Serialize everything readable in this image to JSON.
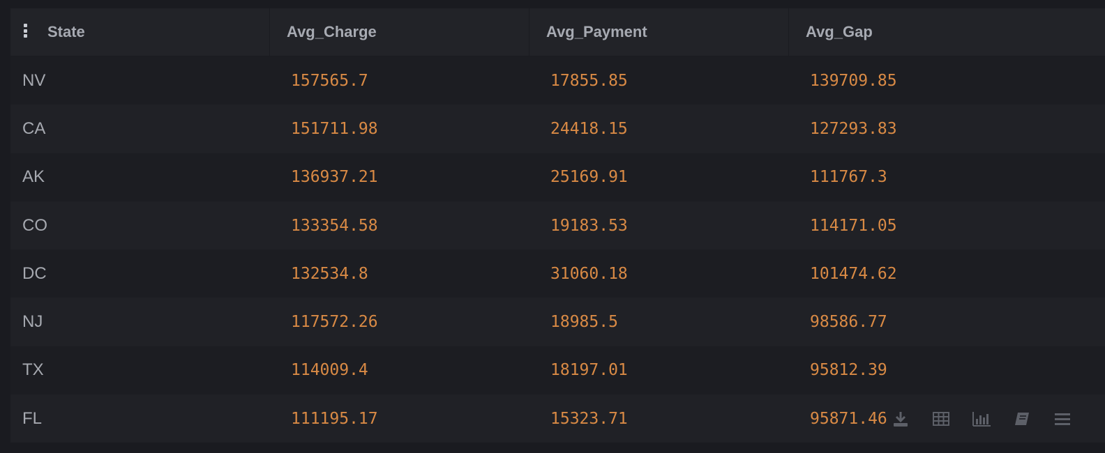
{
  "table": {
    "columns": [
      "State",
      "Avg_Charge",
      "Avg_Payment",
      "Avg_Gap"
    ],
    "rows": [
      {
        "state": "NV",
        "avg_charge": "157565.7",
        "avg_payment": "17855.85",
        "avg_gap": "139709.85"
      },
      {
        "state": "CA",
        "avg_charge": "151711.98",
        "avg_payment": "24418.15",
        "avg_gap": "127293.83"
      },
      {
        "state": "AK",
        "avg_charge": "136937.21",
        "avg_payment": "25169.91",
        "avg_gap": "111767.3"
      },
      {
        "state": "CO",
        "avg_charge": "133354.58",
        "avg_payment": "19183.53",
        "avg_gap": "114171.05"
      },
      {
        "state": "DC",
        "avg_charge": "132534.8",
        "avg_payment": "31060.18",
        "avg_gap": "101474.62"
      },
      {
        "state": "NJ",
        "avg_charge": "117572.26",
        "avg_payment": "18985.5",
        "avg_gap": "98586.77"
      },
      {
        "state": "TX",
        "avg_charge": "114009.4",
        "avg_payment": "18197.01",
        "avg_gap": "95812.39"
      },
      {
        "state": "FL",
        "avg_charge": "111195.17",
        "avg_payment": "15323.71",
        "avg_gap": "95871.46"
      }
    ]
  },
  "toolbar": {
    "icons": [
      "download-icon",
      "table-view-icon",
      "chart-view-icon",
      "notebook-icon",
      "menu-icon"
    ]
  },
  "colors": {
    "background": "#1a1b20",
    "header": "#222328",
    "number_text": "#d98a45",
    "label_text": "#a6a9b0"
  }
}
